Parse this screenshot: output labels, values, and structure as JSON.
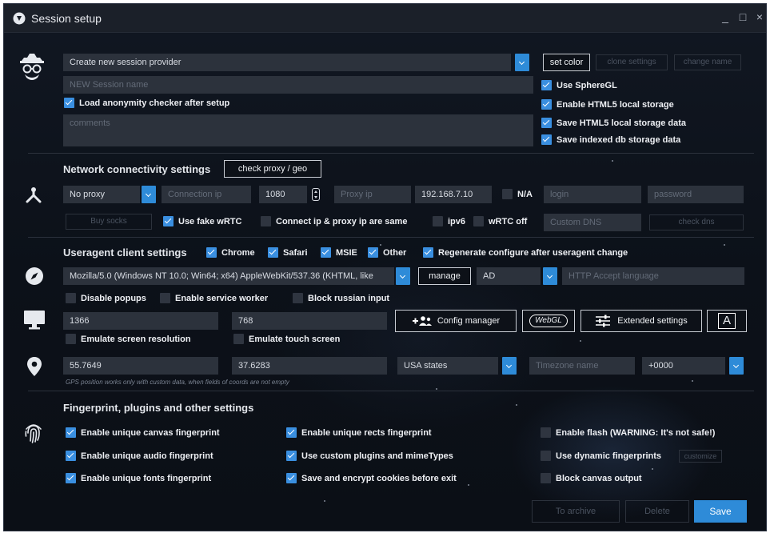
{
  "window": {
    "title": "Session setup"
  },
  "controls": {
    "minimize": "_",
    "maximize": "□",
    "close": "×"
  },
  "session": {
    "provider_value": "Create new session provider",
    "set_color": "set color",
    "clone_settings": "clone settings",
    "change_name": "change name",
    "name_placeholder": "NEW Session name",
    "load_checker": "Load anonymity checker after setup",
    "comments_placeholder": "comments",
    "use_spheregl": "Use SphereGL",
    "enable_html5": "Enable HTML5 local storage",
    "save_html5": "Save HTML5 local storage data",
    "save_indexed": "Save indexed db storage data"
  },
  "network": {
    "title": "Network connectivity settings",
    "check_button": "check proxy / geo",
    "proxy_type": "No proxy",
    "connection_ip_placeholder": "Connection ip",
    "port": "1080",
    "proxy_ip_placeholder": "Proxy ip",
    "local_ip": "192.168.7.10",
    "na": "N/A",
    "login_placeholder": "login",
    "password_placeholder": "password",
    "buy_socks": "Buy socks",
    "fake_webrtc": "Use fake wRTC",
    "connect_same": "Connect ip & proxy ip are same",
    "ipv6": "ipv6",
    "webrtc_off": "wRTC off",
    "custom_dns_placeholder": "Custom DNS",
    "check_dns": "check dns"
  },
  "useragent": {
    "title": "Useragent client settings",
    "chrome": "Chrome",
    "safari": "Safari",
    "msie": "MSIE",
    "other": "Other",
    "regenerate": "Regenerate configure after useragent change",
    "ua_string": "Mozilla/5.0 (Windows NT 10.0; Win64; x64) AppleWebKit/537.36 (KHTML, like",
    "manage": "manage",
    "lang_code": "AD",
    "accept_lang_placeholder": "HTTP Accept language",
    "disable_popups": "Disable popups",
    "enable_sw": "Enable service worker",
    "block_russian": "Block russian input"
  },
  "screen": {
    "width": "1366",
    "height": "768",
    "config_manager": "Config manager",
    "webgl": "WebGL",
    "extended": "Extended settings",
    "a_button": "A",
    "emulate_res": "Emulate screen resolution",
    "emulate_touch": "Emulate touch screen"
  },
  "geo": {
    "lat": "55.7649",
    "lon": "37.6283",
    "region": "USA states",
    "tz_placeholder": "Timezone name",
    "tz_offset": "+0000",
    "note": "GPS position works only with custom data, when fields of coords are not empty"
  },
  "fingerprint": {
    "title": "Fingerprint, plugins and other settings",
    "canvas": "Enable unique canvas fingerprint",
    "audio": "Enable unique audio fingerprint",
    "fonts": "Enable unique fonts fingerprint",
    "rects": "Enable unique rects fingerprint",
    "plugins": "Use custom plugins and mimeTypes",
    "cookies": "Save and encrypt cookies before exit",
    "flash": "Enable flash (WARNING: It's not safe!)",
    "dynamic": "Use dynamic fingerprints",
    "customize": "customize",
    "block_canvas": "Block canvas output"
  },
  "footer": {
    "to_archive": "To archive",
    "delete": "Delete",
    "save": "Save"
  },
  "colors": {
    "accent": "#3a8fe0",
    "field": "#2c323c",
    "background": "#0c1119"
  }
}
